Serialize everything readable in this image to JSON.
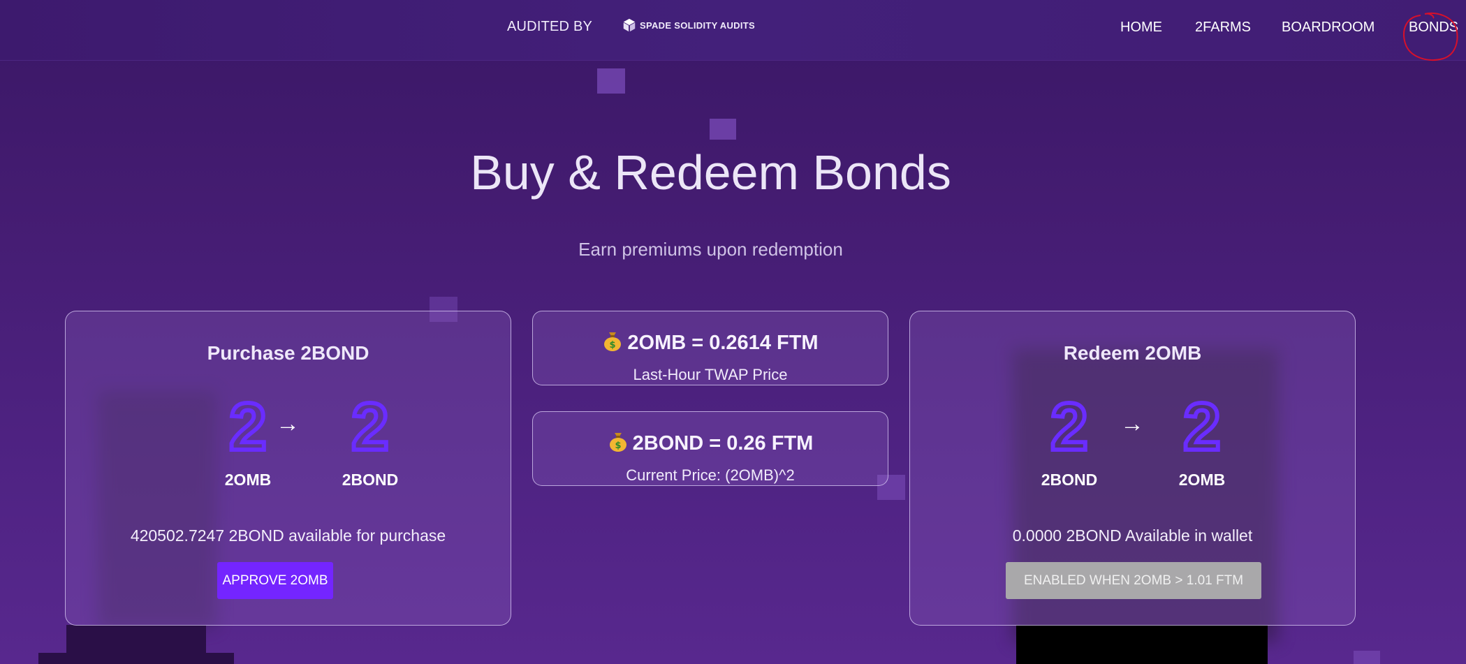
{
  "header": {
    "audited_by": "AUDITED BY",
    "auditor": "SPADE SOLIDITY AUDITS",
    "nav": [
      {
        "label": "HOME",
        "active": false
      },
      {
        "label": "2FARMS",
        "active": false
      },
      {
        "label": "BOARDROOM",
        "active": false
      },
      {
        "label": "BONDS",
        "active": true
      }
    ]
  },
  "hero": {
    "title": "Buy & Redeem Bonds",
    "subtitle": "Earn premiums upon redemption"
  },
  "purchase_card": {
    "title": "Purchase 2BOND",
    "from_glyph": "2",
    "from_token": "2OMB",
    "to_glyph": "2",
    "to_token": "2BOND",
    "arrow": "→",
    "info": "420502.7247 2BOND available for purchase",
    "button": "APPROVE 2OMB"
  },
  "price_cards": [
    {
      "icon": "money-bag-icon",
      "main": "2OMB = 0.2614 FTM",
      "sub": "Last-Hour TWAP Price"
    },
    {
      "icon": "money-bag-icon",
      "main": "2BOND = 0.26 FTM",
      "sub": "Current Price: (2OMB)^2"
    }
  ],
  "redeem_card": {
    "title": "Redeem 2OMB",
    "from_glyph": "2",
    "from_token": "2BOND",
    "to_glyph": "2",
    "to_token": "2OMB",
    "arrow": "→",
    "info": "0.0000 2BOND Available in wallet",
    "button": "ENABLED WHEN 2OMB > 1.01 FTM"
  },
  "colors": {
    "accent": "#7425ff",
    "token_glyph": "#6a2cff",
    "disabled_button": "#a9a8aa",
    "background": "#441c71"
  }
}
